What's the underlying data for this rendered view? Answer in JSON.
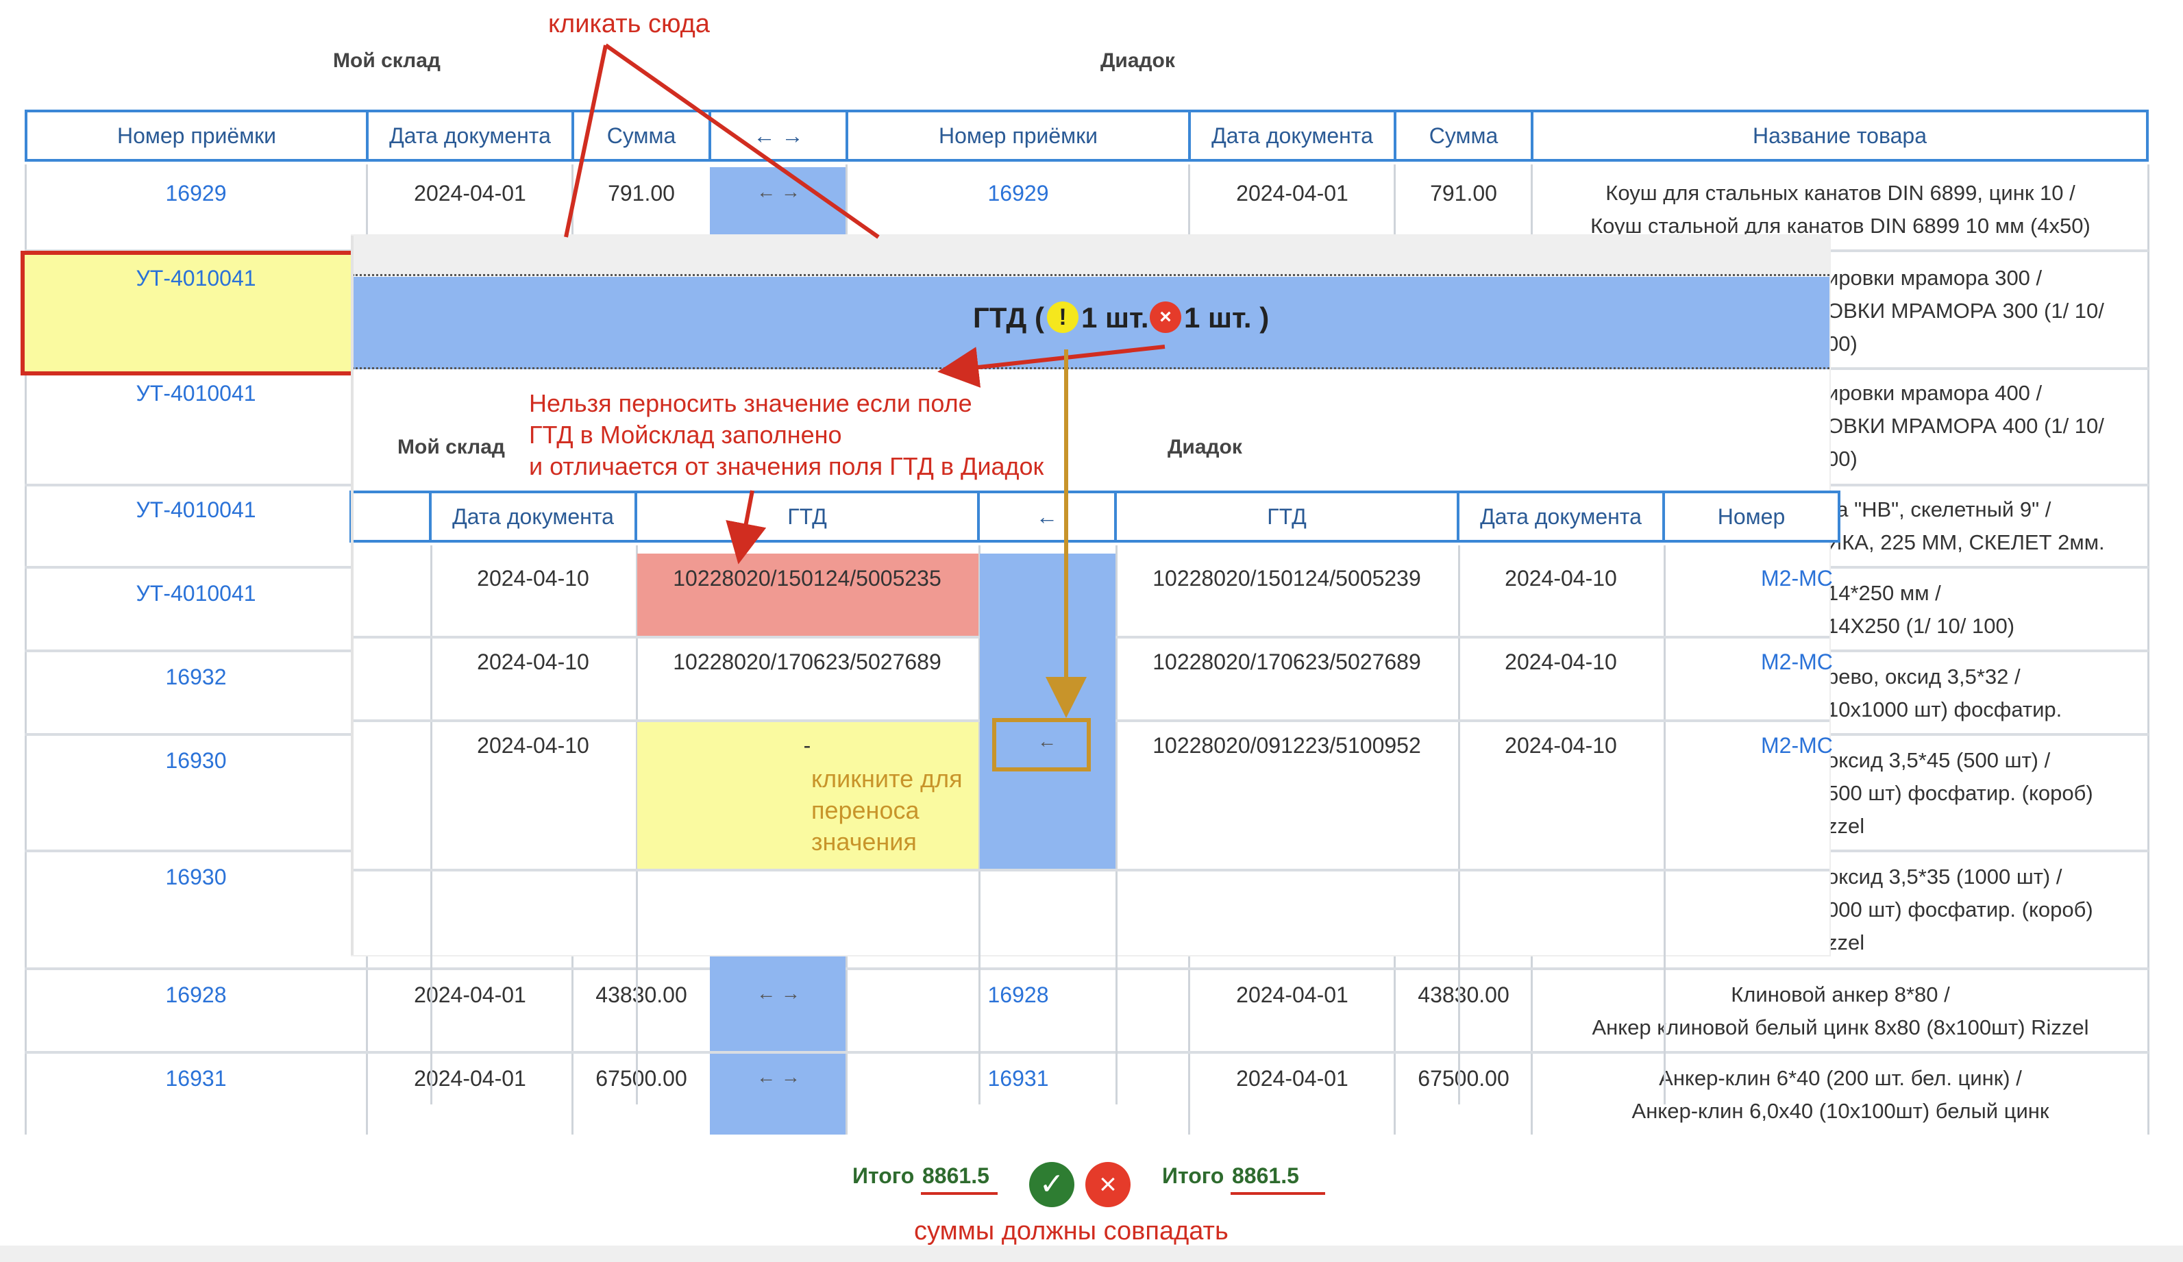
{
  "annotations": {
    "click_here": "кликать сюда",
    "cannot_transfer_1": "Нельзя перносить значение если поле",
    "cannot_transfer_2": "ГТД в Мойсклад заполнено",
    "cannot_transfer_3": "и отличается от значения поля ГТД в Диадок",
    "click_to_transfer_1": "кликните для",
    "click_to_transfer_2": "переноса",
    "click_to_transfer_3": "значения",
    "sums_must_match": "суммы должны совпадать"
  },
  "colors": {
    "accent": "#3b87d6",
    "link": "#2a72d8",
    "action_cell": "#8fb6f0",
    "annotation_red": "#d12d20",
    "annotation_gold": "#c8942a",
    "highlight_yellow": "#fafaa0",
    "error_red": "#f09a92",
    "success_green": "#2e7d32"
  },
  "main": {
    "section_left": "Мой склад",
    "section_right": "Диадок",
    "headers": [
      "Номер приёмки",
      "Дата документа",
      "Сумма",
      "← →",
      "Номер приёмки",
      "Дата документа",
      "Сумма",
      "Название товара"
    ],
    "rows": [
      {
        "num": "16929",
        "date": "2024-04-01",
        "sum": "791.00",
        "action": "← →",
        "num2": "16929",
        "date2": "2024-04-01",
        "sum2": "791.00",
        "name1": "Коуш для стальных канатов DIN 6899, цинк 10 /",
        "name2": "Коуш стальной для канатов DIN 6899 10 мм (4х50)"
      },
      {
        "num": "УТ-4010041",
        "name1": "ировки мрамора 300 /",
        "name2": "ОВКИ МРАМОРА 300 (1/ 10/",
        "name3": "00)"
      },
      {
        "num": "УТ-4010041",
        "name1": "ировки мрамора 400 /",
        "name2": "ОВКИ МРАМОРА 400 (1/ 10/",
        "name3": "00)"
      },
      {
        "num": "УТ-4010041",
        "name1": "ка \"НВ\", скелетный 9\" /",
        "name2": "ИКА, 225 ММ, СКЕЛЕТ 2мм."
      },
      {
        "num": "УТ-4010041",
        "name1": "14*250 мм /",
        "name2": "14Х250 (1/ 10/ 100)"
      },
      {
        "num": "16932",
        "name1": "рево, оксид 3,5*32 /",
        "name2": "10х1000 шт) фосфатир."
      },
      {
        "num": "16930",
        "name1": " оксид 3,5*45 (500 шт) /",
        "name2": "500 шт) фосфатир. (короб)",
        "name3": "zzel"
      },
      {
        "num": "16930",
        "name1": "оксид 3,5*35 (1000 шт) /",
        "name2": "000 шт) фосфатир. (короб)",
        "name3": "zzel"
      },
      {
        "num": "16928",
        "date": "2024-04-01",
        "sum": "43830.00",
        "action": "← →",
        "num2": "16928",
        "date2": "2024-04-01",
        "sum2": "43830.00",
        "name1": "Клиновой анкер 8*80 /",
        "name2": "Анкер клиновой белый цинк 8х80 (8х100шт) Rizzel"
      },
      {
        "num": "16931",
        "date": "2024-04-01",
        "sum": "67500.00",
        "action": "← →",
        "num2": "16931",
        "date2": "2024-04-01",
        "sum2": "67500.00",
        "name1": "Анкер-клин 6*40 (200 шт. бел. цинк) /",
        "name2": "Анкер-клин 6,0х40 (10х100шт) белый цинк"
      }
    ]
  },
  "gtd_panel": {
    "title": "ГТД (",
    "warn_count": "1 шт.",
    "error_count": "1 шт. )",
    "section_left": "Мой склад",
    "section_right": "Диадок",
    "headers": [
      "Дата документа",
      "ГТД",
      "←",
      "ГТД",
      "Дата документа",
      "Номер"
    ],
    "rows": [
      {
        "date": "2024-04-10",
        "gtd_left": "10228020/150124/5005235",
        "arrow": "",
        "gtd_right": "10228020/150124/5005239",
        "date2": "2024-04-10",
        "num": "М2-МС"
      },
      {
        "date": "2024-04-10",
        "gtd_left": "10228020/170623/5027689",
        "arrow": "",
        "gtd_right": "10228020/170623/5027689",
        "date2": "2024-04-10",
        "num": "М2-МС"
      },
      {
        "date": "2024-04-10",
        "gtd_left": "-",
        "arrow": "←",
        "gtd_right": "10228020/091223/5100952",
        "date2": "2024-04-10",
        "num": "М2-МС"
      }
    ]
  },
  "totals": {
    "left_label": "Итого",
    "left_value": "8861.5",
    "right_label": "Итого",
    "right_value": "8861.5"
  }
}
